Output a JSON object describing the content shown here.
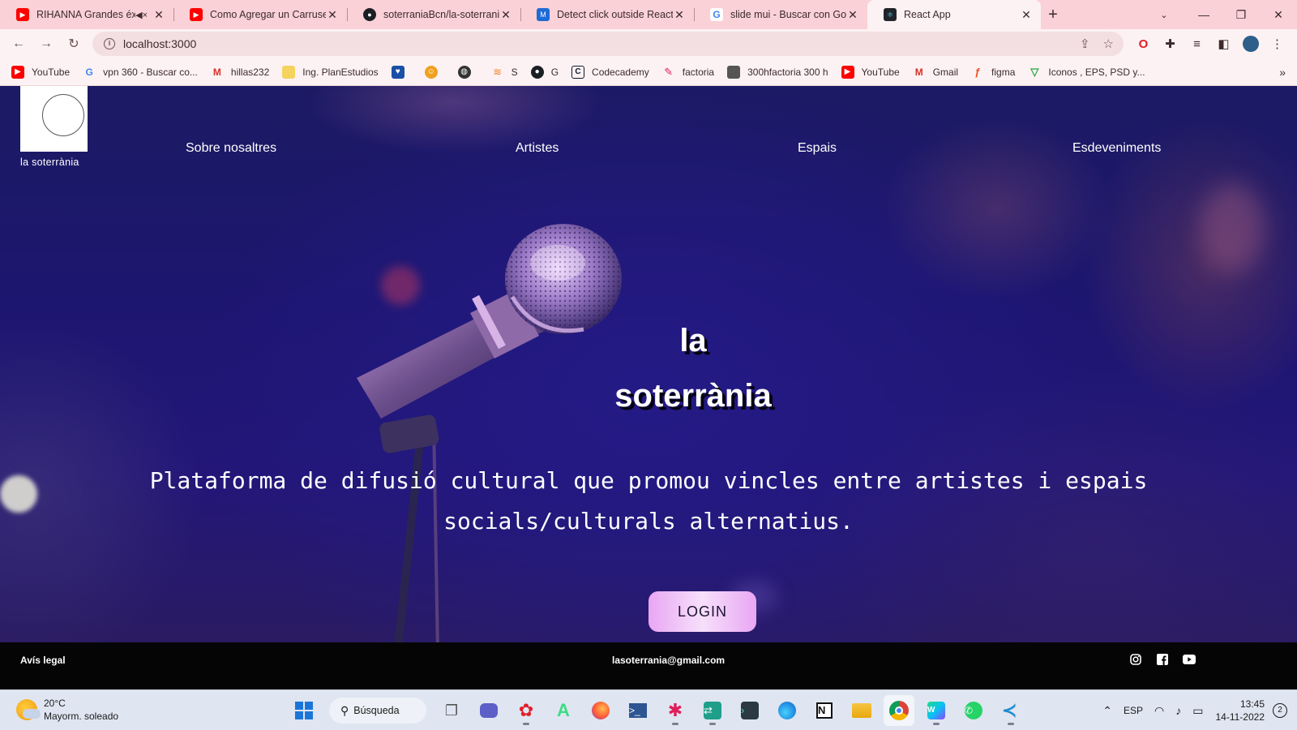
{
  "browser": {
    "tabs": [
      {
        "title": "RIHANNA Grandes éxit",
        "favicon": "youtube-icon",
        "color": "#ff0000",
        "muted": true,
        "active": false
      },
      {
        "title": "Como Agregar un Carrusel",
        "favicon": "youtube-icon",
        "color": "#ff0000",
        "muted": false,
        "active": false
      },
      {
        "title": "soterraniaBcn/la-soterrania",
        "favicon": "github-icon",
        "color": "#1b1f23",
        "muted": false,
        "active": false
      },
      {
        "title": "Detect click outside React c",
        "favicon": "mui-icon",
        "color": "#1e6bd6",
        "muted": false,
        "active": false
      },
      {
        "title": "slide mui - Buscar con Goo",
        "favicon": "google-icon",
        "color": "#4285f4",
        "muted": false,
        "active": false
      },
      {
        "title": "React App",
        "favicon": "react-icon",
        "color": "#20232a",
        "muted": false,
        "active": true
      }
    ],
    "new_tab_label": "+",
    "url": "localhost:3000",
    "bookmarks": [
      {
        "label": "YouTube",
        "icon": "youtube-icon",
        "color": "#ff0000"
      },
      {
        "label": "vpn 360 - Buscar co...",
        "icon": "google-icon",
        "color": "#4285f4"
      },
      {
        "label": "hillas232",
        "icon": "gmail-icon",
        "color": "#d93025"
      },
      {
        "label": "Ing. PlanEstudios",
        "icon": "folder-icon",
        "color": "#f4d35e"
      },
      {
        "label": "",
        "icon": "heart-icon",
        "color": "#1a4fa8"
      },
      {
        "label": "",
        "icon": "smiley-icon",
        "color": "#f0a020"
      },
      {
        "label": "",
        "icon": "globe-icon",
        "color": "#333333"
      },
      {
        "label": "S",
        "icon": "stack-icon",
        "color": "#f48024"
      },
      {
        "label": "G",
        "icon": "github-icon",
        "color": "#1b1f23"
      },
      {
        "label": "Codecademy",
        "icon": "codecademy-icon",
        "color": "#10162f"
      },
      {
        "label": "factoria",
        "icon": "pin-icon",
        "color": "#e0245e"
      },
      {
        "label": "300hfactoria 300 h",
        "icon": "page-icon",
        "color": "#555555"
      },
      {
        "label": "YouTube",
        "icon": "youtube-icon",
        "color": "#ff0000"
      },
      {
        "label": "Gmail",
        "icon": "gmail-icon",
        "color": "#d93025"
      },
      {
        "label": "figma",
        "icon": "figma-icon",
        "color": "#f24e1e"
      },
      {
        "label": "Iconos , EPS, PSD y...",
        "icon": "vector-icon",
        "color": "#28a745"
      }
    ],
    "bookmarks_more": "»"
  },
  "site": {
    "logo_text": "la soterrània",
    "nav": [
      {
        "label": "Sobre nosaltres"
      },
      {
        "label": "Artistes"
      },
      {
        "label": "Espais"
      },
      {
        "label": "Esdeveniments"
      }
    ],
    "hero_title_line1": "la",
    "hero_title_line2": "soterrània",
    "hero_description": "Plataforma de difusió cultural que promou vincles entre artistes i espais socials/culturals alternatius.",
    "login_label": "LOGIN",
    "footer": {
      "legal": "Avís legal",
      "email": "lasoterrania@gmail.com",
      "social": [
        "instagram-icon",
        "facebook-icon",
        "youtube-icon"
      ]
    }
  },
  "taskbar": {
    "weather_temp": "20°C",
    "weather_desc": "Mayorm. soleado",
    "search_label": "Búsqueda",
    "language": "ESP",
    "time": "13:45",
    "date": "14-11-2022",
    "notifications": "2"
  }
}
